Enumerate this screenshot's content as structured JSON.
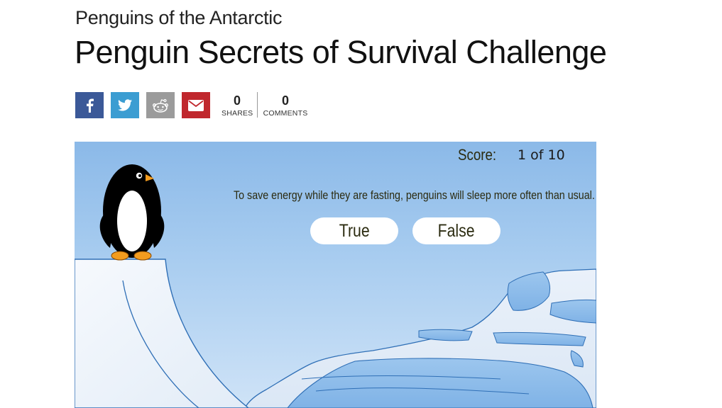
{
  "header": {
    "kicker": "Penguins of the Antarctic",
    "title": "Penguin Secrets of Survival Challenge"
  },
  "share": {
    "buttons": [
      {
        "name": "facebook",
        "icon": "facebook-icon",
        "color": "#3b5998"
      },
      {
        "name": "twitter",
        "icon": "twitter-icon",
        "color": "#3b9dd2"
      },
      {
        "name": "reddit",
        "icon": "reddit-icon",
        "color": "#9b9b9b"
      },
      {
        "name": "email",
        "icon": "envelope-icon",
        "color": "#c0272d"
      }
    ],
    "shares_count": "0",
    "shares_label": "SHARES",
    "comments_count": "0",
    "comments_label": "COMMENTS"
  },
  "game": {
    "score_label": "Score:",
    "score_value": "1 of 10",
    "question": "To save energy while they are fasting, penguins will sleep more often than usual.",
    "answers": {
      "true_label": "True",
      "false_label": "False"
    },
    "colors": {
      "sky_top": "#8bb9e8",
      "ice": "#eef4fb",
      "ice_outline": "#2f6fb6",
      "text": "#2b2b10"
    },
    "icons": [
      "penguin-illustration",
      "ice-cliff",
      "iceberg"
    ]
  }
}
